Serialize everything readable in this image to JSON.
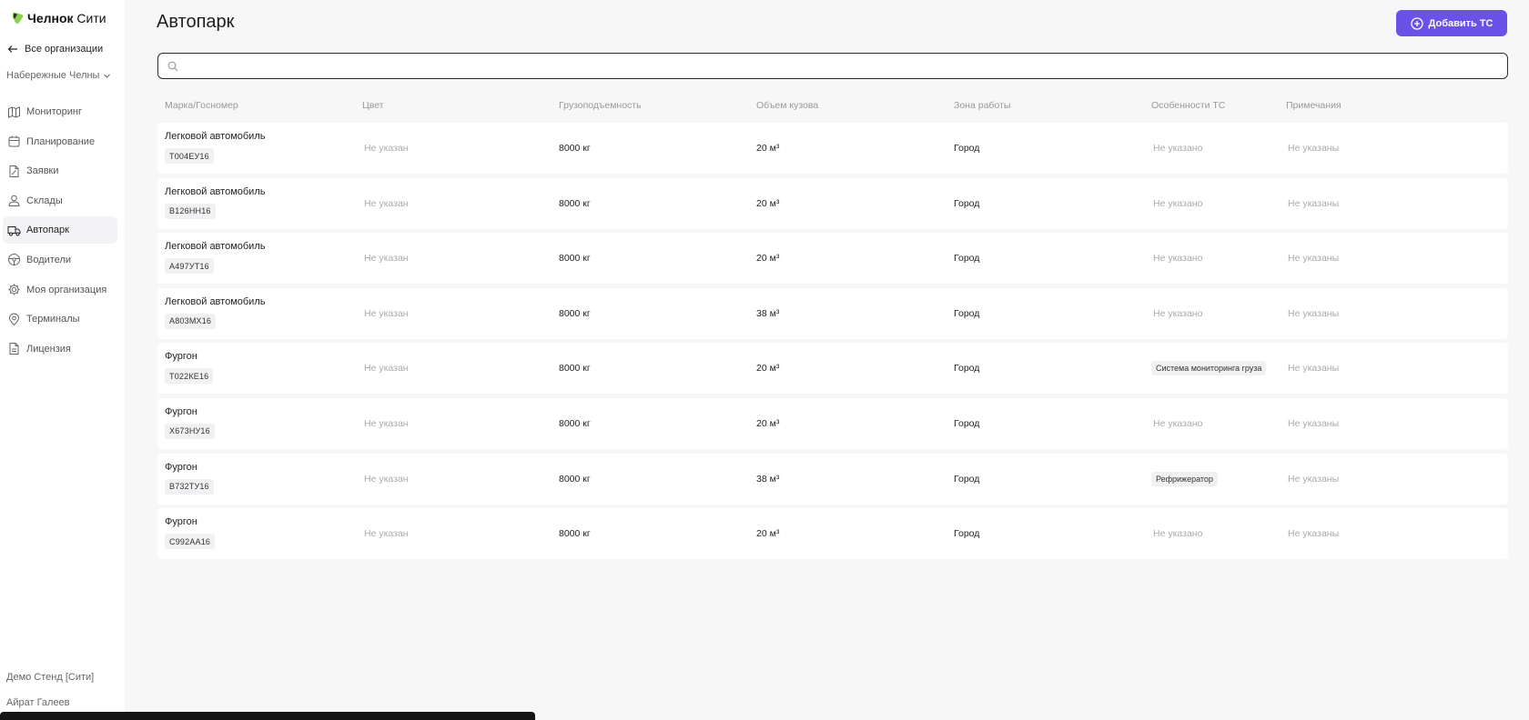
{
  "brand": {
    "name_bold": "Челнок",
    "name_rest": " Сити"
  },
  "sidebar": {
    "back_label": "Все организации",
    "city": "Набережные Челны",
    "items": [
      {
        "label": "Мониторинг",
        "icon": "map-icon"
      },
      {
        "label": "Планирование",
        "icon": "calendar-icon"
      },
      {
        "label": "Заявки",
        "icon": "document-edit-icon"
      },
      {
        "label": "Склады",
        "icon": "warehouse-user-icon"
      },
      {
        "label": "Автопарк",
        "icon": "truck-icon",
        "active": true
      },
      {
        "label": "Водители",
        "icon": "steering-wheel-icon"
      },
      {
        "label": "Моя организация",
        "icon": "gear-icon"
      },
      {
        "label": "Терминалы",
        "icon": "location-gear-icon"
      },
      {
        "label": "Лицензия",
        "icon": "document-icon"
      }
    ],
    "footer_org": "Демо Стенд [Сити]",
    "footer_user": "Айрат Галеев"
  },
  "header": {
    "title": "Автопарк",
    "add_button": "Добавить ТС"
  },
  "search": {
    "value": ""
  },
  "table": {
    "columns": [
      "Марка/Госномер",
      "Цвет",
      "Грузоподъемность",
      "Объем кузова",
      "Зона работы",
      "Особенности ТС",
      "Примечания"
    ],
    "rows": [
      {
        "model": "Легковой автомобиль",
        "plate": "Т004ЕУ16",
        "color": "Не указан",
        "capacity": "8000 кг",
        "volume": "20 м³",
        "zone": "Город",
        "features": "Не указано",
        "notes": "Не указаны"
      },
      {
        "model": "Легковой автомобиль",
        "plate": "В126НН16",
        "color": "Не указан",
        "capacity": "8000 кг",
        "volume": "20 м³",
        "zone": "Город",
        "features": "Не указано",
        "notes": "Не указаны"
      },
      {
        "model": "Легковой автомобиль",
        "plate": "А497УТ16",
        "color": "Не указан",
        "capacity": "8000 кг",
        "volume": "20 м³",
        "zone": "Город",
        "features": "Не указано",
        "notes": "Не указаны"
      },
      {
        "model": "Легковой автомобиль",
        "plate": "А803МХ16",
        "color": "Не указан",
        "capacity": "8000 кг",
        "volume": "38 м³",
        "zone": "Город",
        "features": "Не указано",
        "notes": "Не указаны"
      },
      {
        "model": "Фургон",
        "plate": "Т022КЕ16",
        "color": "Не указан",
        "capacity": "8000 кг",
        "volume": "20 м³",
        "zone": "Город",
        "features_tag": "Система мониторинга груза",
        "notes": "Не указаны"
      },
      {
        "model": "Фургон",
        "plate": "Х673НУ16",
        "color": "Не указан",
        "capacity": "8000 кг",
        "volume": "20 м³",
        "zone": "Город",
        "features": "Не указано",
        "notes": "Не указаны"
      },
      {
        "model": "Фургон",
        "plate": "В732ТУ16",
        "color": "Не указан",
        "capacity": "8000 кг",
        "volume": "38 м³",
        "zone": "Город",
        "features_tag": "Рефрижератор",
        "notes": "Не указаны"
      },
      {
        "model": "Фургон",
        "plate": "С992АА16",
        "color": "Не указан",
        "capacity": "8000 кг",
        "volume": "20 м³",
        "zone": "Город",
        "features": "Не указано",
        "notes": "Не указаны"
      }
    ]
  },
  "colors": {
    "accent": "#6a52e8",
    "brand_green": "#8fd14f",
    "sidebar_active_bg": "#f3f3f5"
  }
}
